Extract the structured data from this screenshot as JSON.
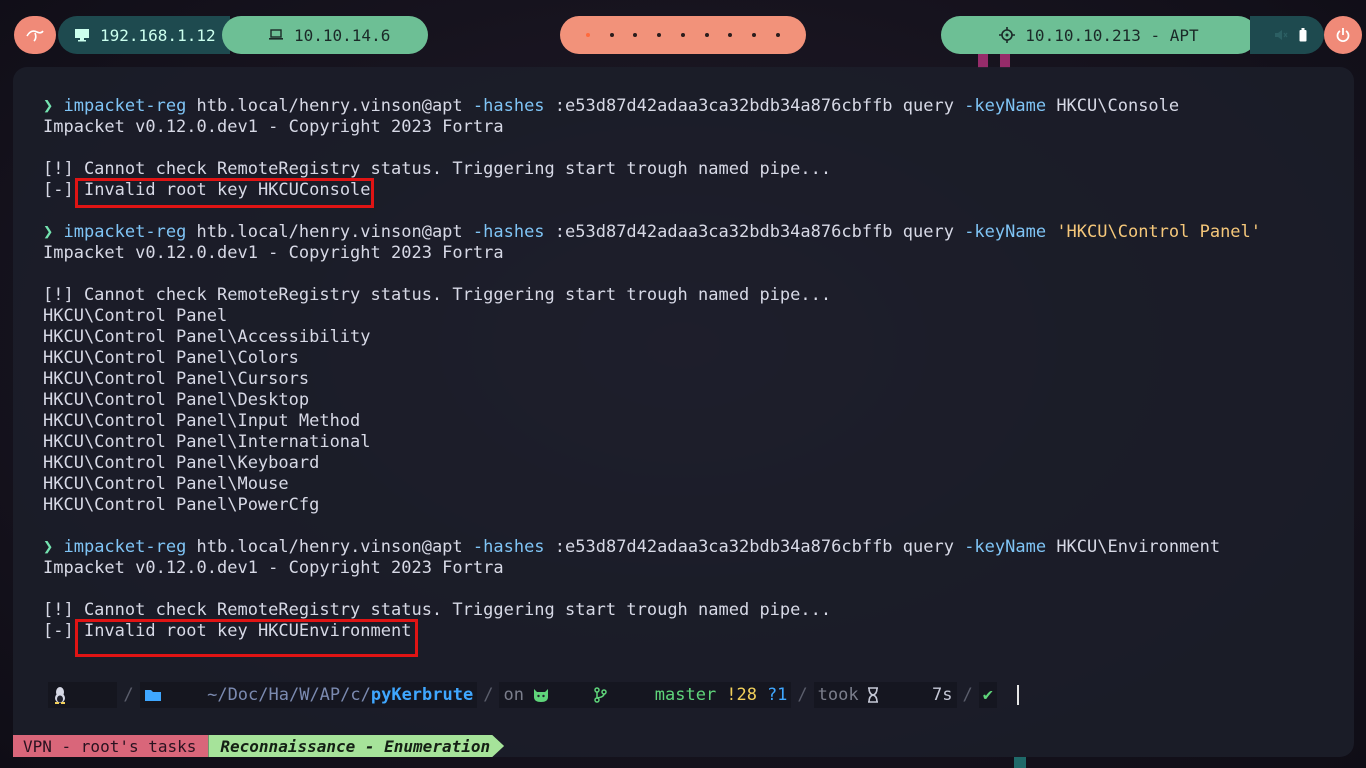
{
  "topbar": {
    "local_ip": "192.168.1.12",
    "vpn_ip": "10.10.14.6",
    "target": "10.10.10.213 - APT",
    "workspace_count": 9,
    "active_workspace": 1
  },
  "terminal": {
    "block1": {
      "cmd": "impacket-reg",
      "arg1": " htb.local/henry.vinson@apt ",
      "flag1": "-hashes",
      "arg2": " :e53d87d42adaa3ca32bdb34a876cbffb query ",
      "flag2": "-keyName",
      "key": " HKCU\\Console",
      "banner": "Impacket v0.12.0.dev1 - Copyright 2023 Fortra",
      "warn": "[!] Cannot check RemoteRegistry status. Triggering start trough named pipe...",
      "err_prefix": "[-] ",
      "err_text": "Invalid root key HKCUConsole"
    },
    "block2": {
      "cmd": "impacket-reg",
      "arg1": " htb.local/henry.vinson@apt ",
      "flag1": "-hashes",
      "arg2": " :e53d87d42adaa3ca32bdb34a876cbffb query ",
      "flag2": "-keyName",
      "key": " 'HKCU\\Control Panel'",
      "banner": "Impacket v0.12.0.dev1 - Copyright 2023 Fortra",
      "warn": "[!] Cannot check RemoteRegistry status. Triggering start trough named pipe...",
      "results": [
        "HKCU\\Control Panel",
        "HKCU\\Control Panel\\Accessibility",
        "HKCU\\Control Panel\\Colors",
        "HKCU\\Control Panel\\Cursors",
        "HKCU\\Control Panel\\Desktop",
        "HKCU\\Control Panel\\Input Method",
        "HKCU\\Control Panel\\International",
        "HKCU\\Control Panel\\Keyboard",
        "HKCU\\Control Panel\\Mouse",
        "HKCU\\Control Panel\\PowerCfg"
      ]
    },
    "block3": {
      "cmd": "impacket-reg",
      "arg1": " htb.local/henry.vinson@apt ",
      "flag1": "-hashes",
      "arg2": " :e53d87d42adaa3ca32bdb34a876cbffb query ",
      "flag2": "-keyName",
      "key": " HKCU\\Environment",
      "banner": "Impacket v0.12.0.dev1 - Copyright 2023 Fortra",
      "warn": "[!] Cannot check RemoteRegistry status. Triggering start trough named pipe...",
      "err_prefix": "[-] ",
      "err_text": "Invalid root key HKCUEnvironment"
    },
    "prompt_arrow": "❯ "
  },
  "promptbar": {
    "path": "~/Doc/Ha/W/AP/c/",
    "repo": "pyKerbrute",
    "on": "on",
    "branch": "master",
    "modified": "!28",
    "untracked": "?1",
    "took": "took",
    "duration": "7s",
    "ok": "✔"
  },
  "footer": {
    "tasks": "VPN - root's tasks",
    "status": "Reconnaissance - Enumeration"
  },
  "colors": {
    "accent_green": "#6dbf95",
    "accent_salmon": "#f2927a",
    "highlight_red": "#e01414"
  }
}
